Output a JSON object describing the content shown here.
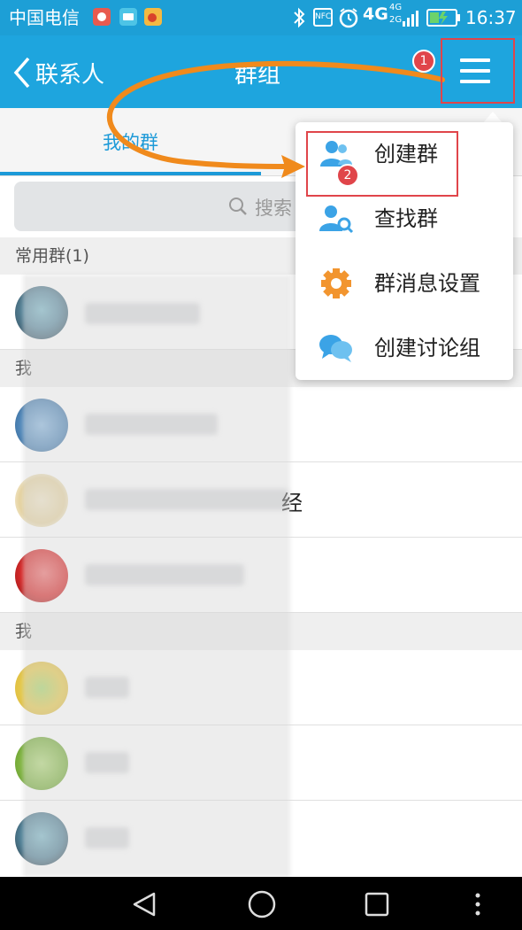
{
  "status_bar": {
    "carrier": "中国电信",
    "network_label": "4G",
    "network_small_top": "4G",
    "network_small_bottom": "2G",
    "nfc_label": "NFC",
    "time": "16:37"
  },
  "header": {
    "back_label": "联系人",
    "title": "群组"
  },
  "tabs": [
    {
      "label": "我的群",
      "selected": true
    },
    {
      "label": "",
      "selected": false
    }
  ],
  "search": {
    "placeholder": "搜索"
  },
  "sections": [
    {
      "label": "常用群(1)"
    },
    {
      "label": "我"
    },
    {
      "label": "我"
    }
  ],
  "list_row_partial_text": "经",
  "menu": {
    "items": [
      {
        "label": "创建群",
        "icon": "create-group-icon"
      },
      {
        "label": "查找群",
        "icon": "find-group-icon"
      },
      {
        "label": "群消息设置",
        "icon": "gear-icon"
      },
      {
        "label": "创建讨论组",
        "icon": "chat-bubbles-icon"
      }
    ]
  },
  "annotations": {
    "step1": "1",
    "step2": "2",
    "highlight_color": "#e0454a",
    "arrow_color": "#f08a1c"
  },
  "colors": {
    "primary": "#1ea5de",
    "status_bar": "#1d9fd6",
    "tab_selected": "#1d9ad8"
  }
}
